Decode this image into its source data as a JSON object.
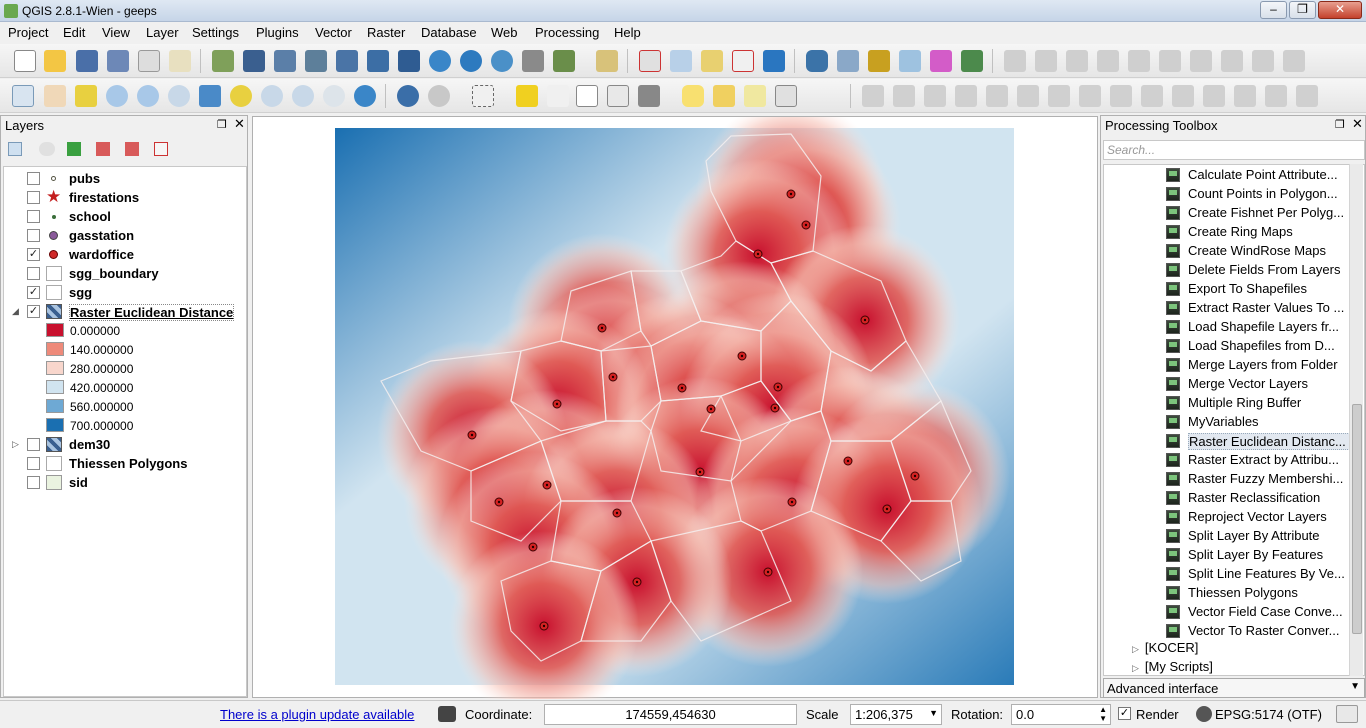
{
  "window": {
    "title": "QGIS 2.8.1-Wien - geeps",
    "minimize": "–",
    "maximize": "❐",
    "close": "✕"
  },
  "menu": [
    "Project",
    "Edit",
    "View",
    "Layer",
    "Settings",
    "Plugins",
    "Vector",
    "Raster",
    "Database",
    "Web",
    "Processing",
    "Help"
  ],
  "layers_panel": {
    "title": "Layers",
    "layers": [
      {
        "name": "pubs",
        "checked": false,
        "symbol": "dot-small"
      },
      {
        "name": "firestations",
        "checked": false,
        "symbol": "star-icon"
      },
      {
        "name": "school",
        "checked": false,
        "symbol": "dot-tiny"
      },
      {
        "name": "gasstation",
        "checked": false,
        "symbol": "dot-purple"
      },
      {
        "name": "wardoffice",
        "checked": true,
        "symbol": "dot-red"
      },
      {
        "name": "sgg_boundary",
        "checked": false,
        "symbol": "fill-empty"
      },
      {
        "name": "sgg",
        "checked": true,
        "symbol": "fill-empty"
      },
      {
        "name": "Raster Euclidean Distance",
        "checked": true,
        "symbol": "raster-icon"
      }
    ],
    "legend": [
      {
        "value": "0.000000",
        "color": "#c8102e"
      },
      {
        "value": "140.000000",
        "color": "#ee8a7a"
      },
      {
        "value": "280.000000",
        "color": "#f8d6cc"
      },
      {
        "value": "420.000000",
        "color": "#d1e4f0"
      },
      {
        "value": "560.000000",
        "color": "#6ea9d4"
      },
      {
        "value": "700.000000",
        "color": "#1a6fb1"
      }
    ],
    "layers_after": [
      {
        "name": "dem30",
        "checked": false,
        "symbol": "raster-icon"
      },
      {
        "name": "Thiessen Polygons",
        "checked": false,
        "symbol": "fill-empty"
      },
      {
        "name": "sid",
        "checked": false,
        "symbol": "fill-light"
      }
    ]
  },
  "toolbox": {
    "title": "Processing Toolbox",
    "search_placeholder": "Search...",
    "algorithms": [
      "Calculate Point Attribute...",
      "Count Points in Polygon...",
      "Create Fishnet Per Polyg...",
      "Create Ring Maps",
      "Create WindRose Maps",
      "Delete Fields From Layers",
      "Export To Shapefiles",
      "Extract Raster Values To ...",
      "Load Shapefile Layers fr...",
      "Load Shapefiles from D...",
      "Merge Layers from Folder",
      "Merge Vector Layers",
      "Multiple Ring Buffer",
      "MyVariables",
      "Raster Euclidean Distanc...",
      "Raster Extract by Attribu...",
      "Raster Fuzzy Membershi...",
      "Raster Reclassification",
      "Reproject Vector Layers",
      "Split Layer By Attribute",
      "Split Layer By Features",
      "Split Line Features By Ve...",
      "Thiessen Polygons",
      "Vector Field Case Conve...",
      "Vector To Raster Conver..."
    ],
    "selected_index": 14,
    "groups": [
      "[KOCER]",
      "[My Scripts]"
    ],
    "interface_mode": "Advanced interface"
  },
  "statusbar": {
    "plugin_update": "There is a plugin update available",
    "coordinate_label": "Coordinate:",
    "coordinate_value": "174559,454630",
    "scale_label": "Scale",
    "scale_value": "1:206,375",
    "rotation_label": "Rotation:",
    "rotation_value": "0.0",
    "render_label": "Render",
    "crs": "EPSG:5174 (OTF)"
  },
  "map": {
    "ward_offices": [
      [
        790,
        193
      ],
      [
        805,
        224
      ],
      [
        757,
        253
      ],
      [
        601,
        327
      ],
      [
        864,
        319
      ],
      [
        741,
        355
      ],
      [
        612,
        376
      ],
      [
        681,
        387
      ],
      [
        777,
        386
      ],
      [
        556,
        403
      ],
      [
        710,
        408
      ],
      [
        774,
        407
      ],
      [
        471,
        434
      ],
      [
        847,
        460
      ],
      [
        699,
        471
      ],
      [
        914,
        475
      ],
      [
        546,
        484
      ],
      [
        498,
        501
      ],
      [
        791,
        501
      ],
      [
        886,
        508
      ],
      [
        616,
        512
      ],
      [
        532,
        546
      ],
      [
        767,
        571
      ],
      [
        636,
        581
      ],
      [
        543,
        625
      ]
    ]
  }
}
